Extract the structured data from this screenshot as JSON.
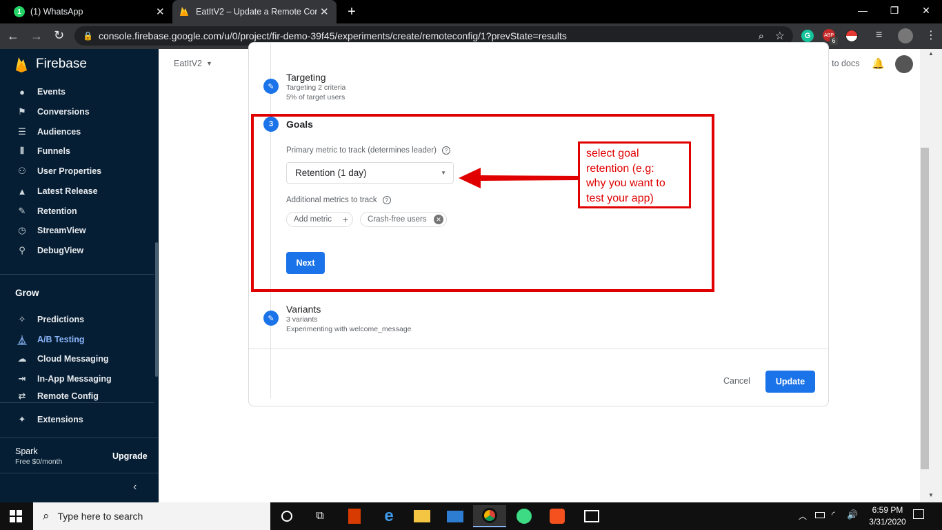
{
  "browser": {
    "tabs": [
      {
        "title": "(1) WhatsApp"
      },
      {
        "title": "EatItV2 – Update a Remote Confi"
      }
    ],
    "url": "console.firebase.google.com/u/0/project/fir-demo-39f45/experiments/create/remoteconfig/1?prevState=results",
    "extension_badge": "6"
  },
  "sidebar": {
    "brand": "Firebase",
    "analytics_items": [
      {
        "label": "Events",
        "icon": "events-icon"
      },
      {
        "label": "Conversions",
        "icon": "flag-icon"
      },
      {
        "label": "Audiences",
        "icon": "audiences-icon"
      },
      {
        "label": "Funnels",
        "icon": "funnel-icon"
      },
      {
        "label": "User Properties",
        "icon": "user-properties-icon"
      },
      {
        "label": "Latest Release",
        "icon": "latest-release-icon"
      },
      {
        "label": "Retention",
        "icon": "retention-icon"
      },
      {
        "label": "StreamView",
        "icon": "clock-icon"
      },
      {
        "label": "DebugView",
        "icon": "debug-icon"
      }
    ],
    "grow_heading": "Grow",
    "grow_items": [
      {
        "label": "Predictions",
        "icon": "predictions-icon"
      },
      {
        "label": "A/B Testing",
        "icon": "flask-icon"
      },
      {
        "label": "Cloud Messaging",
        "icon": "cloud-messaging-icon"
      },
      {
        "label": "In-App Messaging",
        "icon": "in-app-messaging-icon"
      },
      {
        "label": "Remote Config",
        "icon": "remote-config-icon"
      }
    ],
    "extensions": "Extensions",
    "plan_name": "Spark",
    "plan_price": "Free $0/month",
    "upgrade": "Upgrade"
  },
  "header": {
    "project": "EatItV2",
    "docs_link": "Go to docs"
  },
  "steps": {
    "targeting": {
      "title": "Targeting",
      "line1": "Targeting 2 criteria",
      "line2": "5% of target users"
    },
    "goals": {
      "number": "3",
      "title": "Goals",
      "primary_label": "Primary metric to track (determines leader)",
      "primary_value": "Retention (1 day)",
      "additional_label": "Additional metrics to track",
      "add_metric": "Add metric",
      "chip": "Crash-free users",
      "next": "Next"
    },
    "variants": {
      "title": "Variants",
      "line1": "3 variants",
      "line2": "Experimenting with welcome_message"
    }
  },
  "footer": {
    "cancel": "Cancel",
    "update": "Update"
  },
  "annotation": {
    "line1": "select goal",
    "line2": "retention (e.g:",
    "line3": "why you want to",
    "line4": "test your app)"
  },
  "taskbar": {
    "search_placeholder": "Type here to search",
    "time": "6:59 PM",
    "date": "3/31/2020"
  },
  "colors": {
    "accent": "#1a73e8",
    "sidebar": "#051e34",
    "annotation": "#e00000"
  }
}
